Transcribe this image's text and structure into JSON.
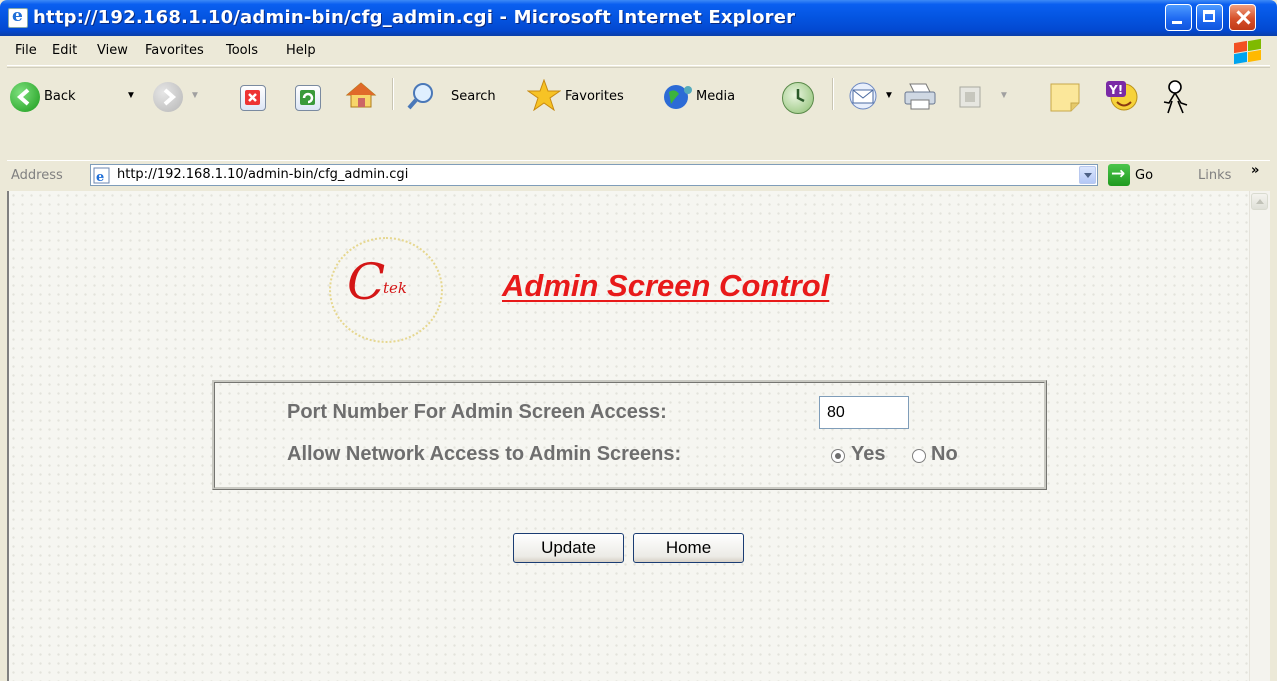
{
  "window": {
    "title": "http://192.168.1.10/admin-bin/cfg_admin.cgi - Microsoft Internet Explorer"
  },
  "menu": {
    "items": [
      "File",
      "Edit",
      "View",
      "Favorites",
      "Tools",
      "Help"
    ]
  },
  "toolbar": {
    "back_label": "Back",
    "search_label": "Search",
    "favorites_label": "Favorites",
    "media_label": "Media"
  },
  "address_bar": {
    "label": "Address",
    "url": "http://192.168.1.10/admin-bin/cfg_admin.cgi",
    "go_label": "Go",
    "links_label": "Links",
    "links_more": "»"
  },
  "page": {
    "logo_letter": "C",
    "logo_text": "tek",
    "title": "Admin Screen Control",
    "form": {
      "port_label": "Port Number For Admin Screen Access:",
      "port_value": "80",
      "network_label": "Allow Network Access to Admin Screens:",
      "options": [
        {
          "label": "Yes",
          "checked": true
        },
        {
          "label": "No",
          "checked": false
        }
      ]
    },
    "buttons": {
      "update": "Update",
      "home": "Home"
    }
  },
  "colors": {
    "title_red": "#e81a1a",
    "titlebar_blue": "#0454e0",
    "form_text": "#6e6e6e"
  }
}
